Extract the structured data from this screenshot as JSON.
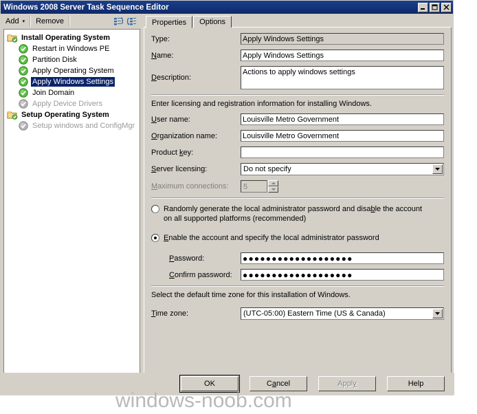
{
  "window": {
    "title": "Windows 2008 Server Task Sequence Editor",
    "buttons": {
      "minimize": "minimize-icon",
      "maximize": "maximize-icon",
      "close": "close-icon"
    }
  },
  "toolbar": {
    "add_label": "Add",
    "add_caret": "▾",
    "remove_label": "Remove",
    "move_up_icon": "move-up-icon",
    "move_down_icon": "move-down-icon"
  },
  "tree": {
    "items": [
      {
        "label": "Install Operating System",
        "type": "group",
        "icon": "folder-icon",
        "state": "enabled",
        "selected": false
      },
      {
        "label": "Restart in Windows PE",
        "type": "child",
        "icon": "green-check-icon",
        "state": "enabled",
        "selected": false
      },
      {
        "label": "Partition Disk",
        "type": "child",
        "icon": "green-check-icon",
        "state": "enabled",
        "selected": false
      },
      {
        "label": "Apply Operating System",
        "type": "child",
        "icon": "green-check-icon",
        "state": "enabled",
        "selected": false
      },
      {
        "label": "Apply Windows Settings",
        "type": "child",
        "icon": "green-check-icon",
        "state": "enabled",
        "selected": true
      },
      {
        "label": "Join Domain",
        "type": "child",
        "icon": "green-check-icon",
        "state": "enabled",
        "selected": false
      },
      {
        "label": "Apply Device Drivers",
        "type": "child",
        "icon": "gray-check-icon",
        "state": "disabled",
        "selected": false
      },
      {
        "label": "Setup Operating System",
        "type": "group",
        "icon": "folder-icon",
        "state": "enabled",
        "selected": false
      },
      {
        "label": "Setup windows and ConfigMgr",
        "type": "child",
        "icon": "gray-check-icon",
        "state": "disabled",
        "selected": false
      }
    ]
  },
  "tabs": [
    {
      "label": "Properties",
      "active": true
    },
    {
      "label": "Options",
      "active": false
    }
  ],
  "properties": {
    "type_label": "Type:",
    "type_value": "Apply Windows Settings",
    "name_label": "Name:",
    "name_label_underline": "N",
    "name_value": "Apply Windows Settings",
    "description_label": "Description:",
    "description_label_underline": "D",
    "description_value": "Actions to apply windows settings",
    "licensing_note": "Enter licensing and registration information for installing Windows.",
    "user_name_label": "User name:",
    "user_name_underline": "U",
    "user_name_value": "Louisville Metro Government",
    "organization_label": "Organization name:",
    "organization_underline": "O",
    "organization_value": "Louisville Metro Government",
    "product_key_label": "Product key:",
    "product_key_underline": "k",
    "product_key_value": "",
    "server_licensing_label": "Server licensing:",
    "server_licensing_underline": "S",
    "server_licensing_value": "Do not specify",
    "max_connections_label": "Maximum connections:",
    "max_connections_underline": "M",
    "max_connections_value": "5",
    "radio_random_label_a": "Randomly generate the local administrator password and disa",
    "radio_random_underline": "b",
    "radio_random_label_b": "le the account",
    "radio_random_line2": "on all supported platforms (recommended)",
    "radio_random_selected": false,
    "radio_enable_underline": "E",
    "radio_enable_label": "nable the account and specify the local administrator password",
    "radio_enable_selected": true,
    "password_label": "Password:",
    "password_underline": "P",
    "password_value": "●●●●●●●●●●●●●●●●●●●",
    "confirm_label": "Confirm password:",
    "confirm_underline": "C",
    "confirm_value": "●●●●●●●●●●●●●●●●●●●",
    "timezone_note": "Select the default time zone for this installation of Windows.",
    "timezone_label": "Time zone:",
    "timezone_underline": "T",
    "timezone_value": "(UTC-05:00) Eastern Time (US & Canada)"
  },
  "footer": {
    "ok": "OK",
    "cancel_a": "C",
    "cancel_underline": "a",
    "cancel_b": "ncel",
    "apply_a": "Appl",
    "apply_underline": "y",
    "apply_disabled": true,
    "help": "Help"
  },
  "watermark": "windows-noob.com",
  "colors": {
    "title_bar": "#14337a",
    "window_face": "#d4d0c8",
    "selection": "#0a246a",
    "field_bg": "#ffffff",
    "disabled_text": "#808080"
  }
}
